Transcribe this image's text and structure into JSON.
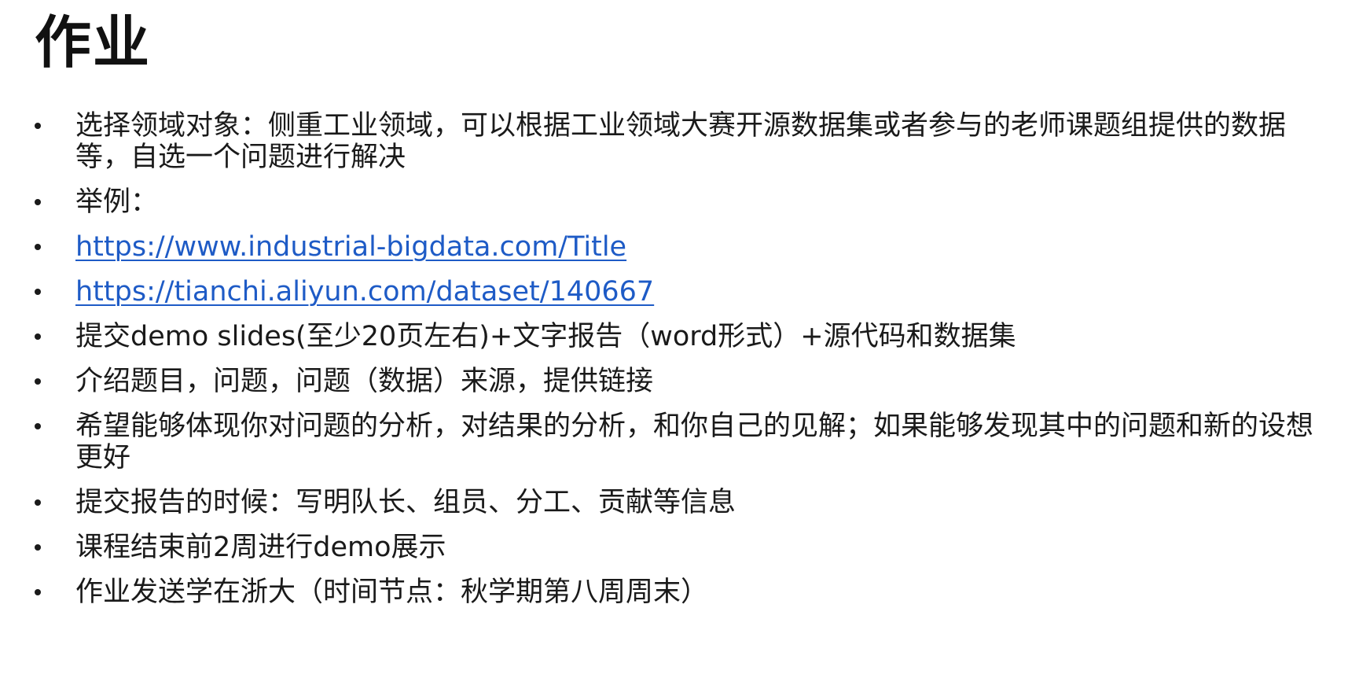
{
  "slide": {
    "title": "作业",
    "bullets": [
      {
        "text": "选择领域对象：侧重工业领域，可以根据工业领域大赛开源数据集或者参与的老师课题组提供的数据等，自选一个问题进行解决"
      },
      {
        "text": "举例："
      },
      {
        "link": "https://www.industrial-bigdata.com/Title"
      },
      {
        "link": "https://tianchi.aliyun.com/dataset/140667"
      },
      {
        "text": "提交demo slides(至少20页左右)+文字报告（word形式）+源代码和数据集"
      },
      {
        "text": "介绍题目，问题，问题（数据）来源，提供链接"
      },
      {
        "text": "希望能够体现你对问题的分析，对结果的分析，和你自己的见解；如果能够发现其中的问题和新的设想更好"
      },
      {
        "text": "提交报告的时候：写明队长、组员、分工、贡献等信息"
      },
      {
        "text": "课程结束前2周进行demo展示"
      },
      {
        "text": "作业发送学在浙大（时间节点：秋学期第八周周末）"
      }
    ]
  },
  "colors": {
    "text": "#1a1a1a",
    "link": "#1e5bc6",
    "background": "#ffffff"
  }
}
